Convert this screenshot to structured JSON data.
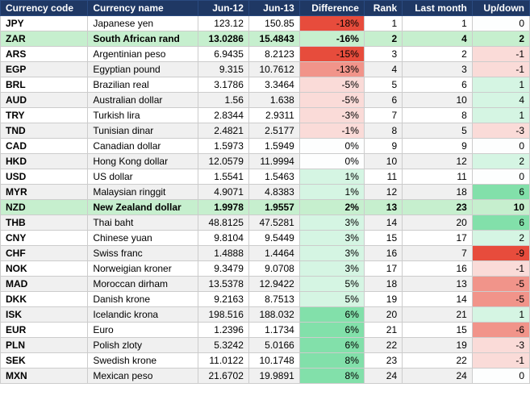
{
  "headers": {
    "code": "Currency code",
    "name": "Currency name",
    "jun12": "Jun-12",
    "jun13": "Jun-13",
    "difference": "Difference",
    "rank": "Rank",
    "lastMonth": "Last month",
    "updown": "Up/down"
  },
  "rows": [
    {
      "code": "JPY",
      "name": "Japanese yen",
      "jun12": "123.12",
      "jun13": "150.85",
      "diff": "-18%",
      "diffClass": "diff-neg-large",
      "rank": 1,
      "lastMonth": 1,
      "updownVal": 0,
      "updownClass": "updown-zero"
    },
    {
      "code": "ZAR",
      "name": "South African rand",
      "jun12": "13.0286",
      "jun13": "15.4843",
      "diff": "-16%",
      "diffClass": "diff-neg-large",
      "rank": 2,
      "lastMonth": 4,
      "updownVal": 2,
      "updownClass": "updown-pos-small",
      "selected": true
    },
    {
      "code": "ARS",
      "name": "Argentinian peso",
      "jun12": "6.9435",
      "jun13": "8.2123",
      "diff": "-15%",
      "diffClass": "diff-neg-large",
      "rank": 3,
      "lastMonth": 2,
      "updownVal": -1,
      "updownClass": "updown-neg-small"
    },
    {
      "code": "EGP",
      "name": "Egyptian pound",
      "jun12": "9.315",
      "jun13": "10.7612",
      "diff": "-13%",
      "diffClass": "diff-neg-med",
      "rank": 4,
      "lastMonth": 3,
      "updownVal": -1,
      "updownClass": "updown-neg-small"
    },
    {
      "code": "BRL",
      "name": "Brazilian real",
      "jun12": "3.1786",
      "jun13": "3.3464",
      "diff": "-5%",
      "diffClass": "diff-neg-small",
      "rank": 5,
      "lastMonth": 6,
      "updownVal": 1,
      "updownClass": "updown-pos-small"
    },
    {
      "code": "AUD",
      "name": "Australian dollar",
      "jun12": "1.56",
      "jun13": "1.638",
      "diff": "-5%",
      "diffClass": "diff-neg-small",
      "rank": 6,
      "lastMonth": 10,
      "updownVal": 4,
      "updownClass": "updown-pos-small"
    },
    {
      "code": "TRY",
      "name": "Turkish lira",
      "jun12": "2.8344",
      "jun13": "2.9311",
      "diff": "-3%",
      "diffClass": "diff-neg-small",
      "rank": 7,
      "lastMonth": 8,
      "updownVal": 1,
      "updownClass": "updown-pos-small"
    },
    {
      "code": "TND",
      "name": "Tunisian dinar",
      "jun12": "2.4821",
      "jun13": "2.5177",
      "diff": "-1%",
      "diffClass": "diff-neg-small",
      "rank": 8,
      "lastMonth": 5,
      "updownVal": -3,
      "updownClass": "updown-neg-small"
    },
    {
      "code": "CAD",
      "name": "Canadian dollar",
      "jun12": "1.5973",
      "jun13": "1.5949",
      "diff": "0%",
      "diffClass": "diff-zero",
      "rank": 9,
      "lastMonth": 9,
      "updownVal": 0,
      "updownClass": "updown-zero"
    },
    {
      "code": "HKD",
      "name": "Hong Kong dollar",
      "jun12": "12.0579",
      "jun13": "11.9994",
      "diff": "0%",
      "diffClass": "diff-zero",
      "rank": 10,
      "lastMonth": 12,
      "updownVal": 2,
      "updownClass": "updown-pos-small"
    },
    {
      "code": "USD",
      "name": "US dollar",
      "jun12": "1.5541",
      "jun13": "1.5463",
      "diff": "1%",
      "diffClass": "diff-pos-small",
      "rank": 11,
      "lastMonth": 11,
      "updownVal": 0,
      "updownClass": "updown-zero"
    },
    {
      "code": "MYR",
      "name": "Malaysian ringgit",
      "jun12": "4.9071",
      "jun13": "4.8383",
      "diff": "1%",
      "diffClass": "diff-pos-small",
      "rank": 12,
      "lastMonth": 18,
      "updownVal": 6,
      "updownClass": "updown-pos-med"
    },
    {
      "code": "NZD",
      "name": "New Zealand dollar",
      "jun12": "1.9978",
      "jun13": "1.9557",
      "diff": "2%",
      "diffClass": "diff-pos-small",
      "rank": 13,
      "lastMonth": 23,
      "updownVal": 10,
      "updownClass": "updown-pos-large",
      "selected": true
    },
    {
      "code": "THB",
      "name": "Thai baht",
      "jun12": "48.8125",
      "jun13": "47.5281",
      "diff": "3%",
      "diffClass": "diff-pos-small",
      "rank": 14,
      "lastMonth": 20,
      "updownVal": 6,
      "updownClass": "updown-pos-med"
    },
    {
      "code": "CNY",
      "name": "Chinese yuan",
      "jun12": "9.8104",
      "jun13": "9.5449",
      "diff": "3%",
      "diffClass": "diff-pos-small",
      "rank": 15,
      "lastMonth": 17,
      "updownVal": 2,
      "updownClass": "updown-pos-small"
    },
    {
      "code": "CHF",
      "name": "Swiss franc",
      "jun12": "1.4888",
      "jun13": "1.4464",
      "diff": "3%",
      "diffClass": "diff-pos-small",
      "rank": 16,
      "lastMonth": 7,
      "updownVal": -9,
      "updownClass": "updown-neg-large"
    },
    {
      "code": "NOK",
      "name": "Norweigian kroner",
      "jun12": "9.3479",
      "jun13": "9.0708",
      "diff": "3%",
      "diffClass": "diff-pos-small",
      "rank": 17,
      "lastMonth": 16,
      "updownVal": -1,
      "updownClass": "updown-neg-small"
    },
    {
      "code": "MAD",
      "name": "Moroccan dirham",
      "jun12": "13.5378",
      "jun13": "12.9422",
      "diff": "5%",
      "diffClass": "diff-pos-small",
      "rank": 18,
      "lastMonth": 13,
      "updownVal": -5,
      "updownClass": "updown-neg-med"
    },
    {
      "code": "DKK",
      "name": "Danish krone",
      "jun12": "9.2163",
      "jun13": "8.7513",
      "diff": "5%",
      "diffClass": "diff-pos-small",
      "rank": 19,
      "lastMonth": 14,
      "updownVal": -5,
      "updownClass": "updown-neg-med"
    },
    {
      "code": "ISK",
      "name": "Icelandic krona",
      "jun12": "198.516",
      "jun13": "188.032",
      "diff": "6%",
      "diffClass": "diff-pos-med",
      "rank": 20,
      "lastMonth": 21,
      "updownVal": 1,
      "updownClass": "updown-pos-small"
    },
    {
      "code": "EUR",
      "name": "Euro",
      "jun12": "1.2396",
      "jun13": "1.1734",
      "diff": "6%",
      "diffClass": "diff-pos-med",
      "rank": 21,
      "lastMonth": 15,
      "updownVal": -6,
      "updownClass": "updown-neg-med"
    },
    {
      "code": "PLN",
      "name": "Polish zloty",
      "jun12": "5.3242",
      "jun13": "5.0166",
      "diff": "6%",
      "diffClass": "diff-pos-med",
      "rank": 22,
      "lastMonth": 19,
      "updownVal": -3,
      "updownClass": "updown-neg-small"
    },
    {
      "code": "SEK",
      "name": "Swedish krone",
      "jun12": "11.0122",
      "jun13": "10.1748",
      "diff": "8%",
      "diffClass": "diff-pos-med",
      "rank": 23,
      "lastMonth": 22,
      "updownVal": -1,
      "updownClass": "updown-neg-small"
    },
    {
      "code": "MXN",
      "name": "Mexican peso",
      "jun12": "21.6702",
      "jun13": "19.9891",
      "diff": "8%",
      "diffClass": "diff-pos-med",
      "rank": 24,
      "lastMonth": 24,
      "updownVal": 0,
      "updownClass": "updown-zero"
    }
  ]
}
